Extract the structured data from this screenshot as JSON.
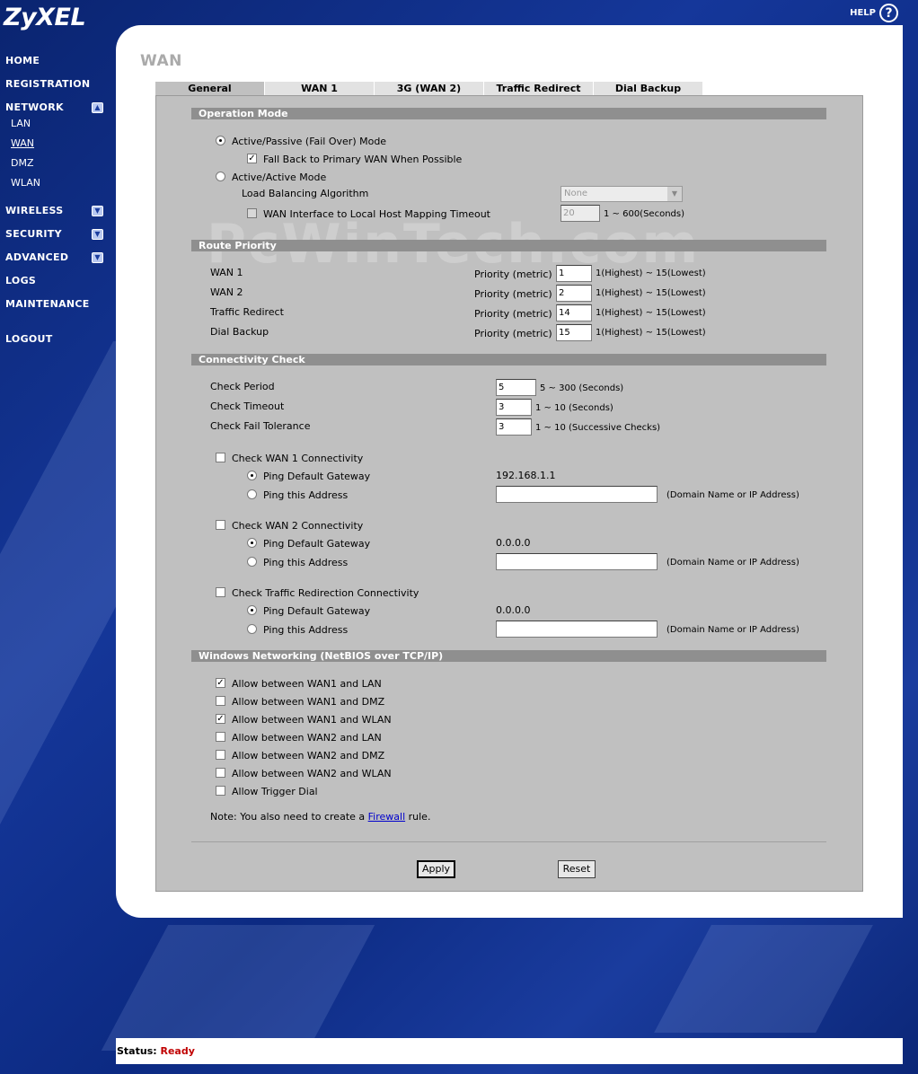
{
  "brand": {
    "logo": "ZyXEL",
    "help": "HELP",
    "help_glyph": "?"
  },
  "sidebar": {
    "home": "HOME",
    "registration": "REGISTRATION",
    "network": "NETWORK",
    "network_sub": {
      "lan": "LAN",
      "wan": "WAN",
      "dmz": "DMZ",
      "wlan": "WLAN"
    },
    "wireless": "WIRELESS",
    "security": "SECURITY",
    "advanced": "ADVANCED",
    "logs": "LOGS",
    "maintenance": "MAINTENANCE",
    "logout": "LOGOUT"
  },
  "page": {
    "title": "WAN",
    "watermark": "PcWinTech.com"
  },
  "tabs": {
    "general": "General",
    "wan1": "WAN 1",
    "wan2": "3G (WAN 2)",
    "traffic": "Traffic Redirect",
    "dial": "Dial Backup"
  },
  "operation_mode": {
    "header": "Operation Mode",
    "active_passive": "Active/Passive (Fail Over) Mode",
    "fall_back": "Fall Back to Primary WAN When Possible",
    "active_active": "Active/Active Mode",
    "lb_algorithm": "Load Balancing Algorithm",
    "lb_value": "None",
    "mapping_timeout": "WAN Interface to Local Host Mapping Timeout",
    "mapping_value": "20",
    "mapping_range": "1 ~ 600(Seconds)"
  },
  "route_priority": {
    "header": "Route Priority",
    "priority_label": "Priority (metric)",
    "range": "1(Highest) ~ 15(Lowest)",
    "rows": [
      {
        "name": "WAN 1",
        "value": "1"
      },
      {
        "name": "WAN 2",
        "value": "2"
      },
      {
        "name": "Traffic Redirect",
        "value": "14"
      },
      {
        "name": "Dial Backup",
        "value": "15"
      }
    ]
  },
  "connectivity": {
    "header": "Connectivity Check",
    "check_period": "Check Period",
    "check_period_value": "5",
    "check_period_range": "5 ~ 300 (Seconds)",
    "check_timeout": "Check Timeout",
    "check_timeout_value": "3",
    "check_timeout_range": "1 ~ 10 (Seconds)",
    "fail_tolerance": "Check Fail Tolerance",
    "fail_tolerance_value": "3",
    "fail_tolerance_range": "1 ~ 10 (Successive Checks)",
    "ping_gateway": "Ping Default Gateway",
    "ping_address": "Ping this Address",
    "address_hint": "(Domain Name or IP Address)",
    "wan1": {
      "label": "Check WAN 1 Connectivity",
      "gateway": "192.168.1.1"
    },
    "wan2": {
      "label": "Check WAN 2 Connectivity",
      "gateway": "0.0.0.0"
    },
    "traffic": {
      "label": "Check Traffic Redirection Connectivity",
      "gateway": "0.0.0.0"
    }
  },
  "netbios": {
    "header": "Windows Networking (NetBIOS over TCP/IP)",
    "items": [
      {
        "label": "Allow between WAN1 and LAN",
        "checked": true
      },
      {
        "label": "Allow between WAN1 and DMZ",
        "checked": false
      },
      {
        "label": "Allow between WAN1 and WLAN",
        "checked": true
      },
      {
        "label": "Allow between WAN2 and LAN",
        "checked": false
      },
      {
        "label": "Allow between WAN2 and DMZ",
        "checked": false
      },
      {
        "label": "Allow between WAN2 and WLAN",
        "checked": false
      },
      {
        "label": "Allow Trigger Dial",
        "checked": false
      }
    ],
    "note_prefix": "Note: You also need to create a",
    "note_link": "Firewall",
    "note_suffix": "rule."
  },
  "buttons": {
    "apply": "Apply",
    "reset": "Reset"
  },
  "status": {
    "label": "Status:",
    "value": "Ready"
  }
}
